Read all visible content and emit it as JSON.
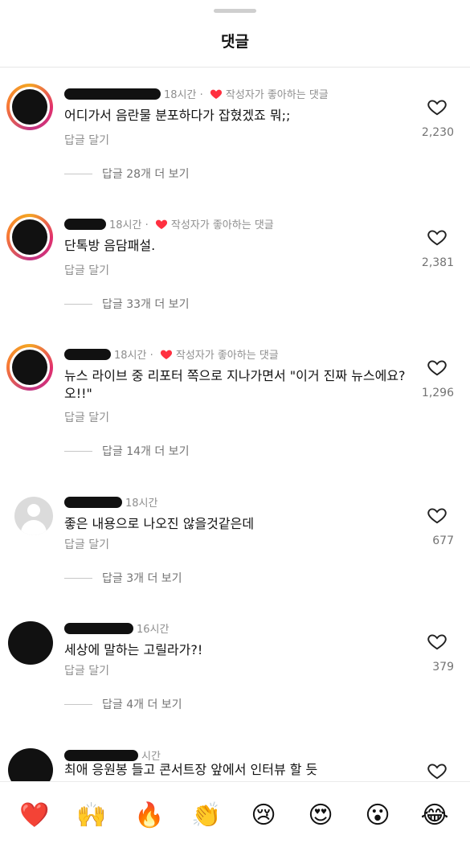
{
  "header": {
    "title": "댓글"
  },
  "reply_label": "답글 달기",
  "creator_liked_label": "작성자가 좋아하는 댓글",
  "comments": [
    {
      "time": "18시간",
      "text": "어디가서 음란물 분포하다가 잡혔겠죠 뭐;;",
      "likes": "2,230",
      "more_replies": "답글 28개 더 보기",
      "creator_liked": true
    },
    {
      "time": "18시간",
      "text": "단톡방 음담패설.",
      "likes": "2,381",
      "more_replies": "답글 33개 더 보기",
      "creator_liked": true
    },
    {
      "time": "18시간",
      "text": "뉴스 라이브 중 리포터 쪽으로 지나가면서 \"이거 진짜 뉴스에요? 오!!\"",
      "likes": "1,296",
      "more_replies": "답글 14개 더 보기",
      "creator_liked": true
    },
    {
      "time": "18시간",
      "text": "좋은 내용으로 나오진 않을것같은데",
      "likes": "677",
      "more_replies": "답글 3개 더 보기",
      "creator_liked": false
    },
    {
      "time": "16시간",
      "text": "세상에 말하는 고릴라가?!",
      "likes": "379",
      "more_replies": "답글 4개 더 보기",
      "creator_liked": false
    },
    {
      "time": "시간",
      "text": "최애 응원봉 들고 콘서트장 앞에서 인터뷰 할 듯",
      "likes": "",
      "more_replies": "",
      "creator_liked": false
    }
  ],
  "quick_reactions": [
    "❤️",
    "🙌",
    "🔥",
    "👏",
    "😢",
    "😍",
    "😮",
    "😂"
  ],
  "colors": {
    "accent_red": "#ff3040",
    "secondary_text": "#8e8e8e"
  },
  "icons": {
    "like": "heart-outline-icon",
    "creator_like": "heart-filled-icon"
  }
}
